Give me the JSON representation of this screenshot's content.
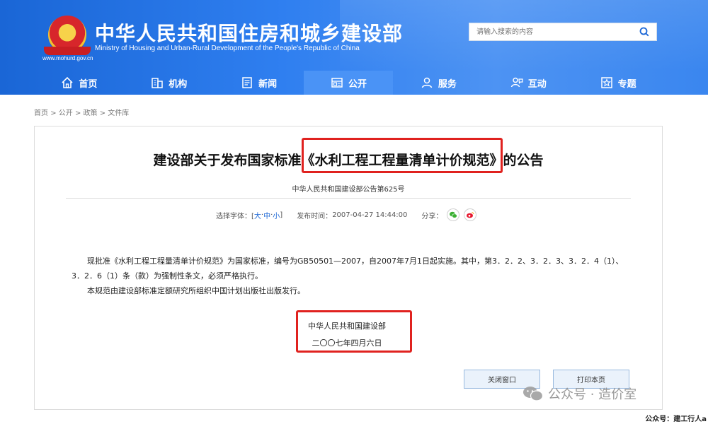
{
  "header": {
    "title": "中华人民共和国住房和城乡建设部",
    "subtitle": "Ministry of Housing and Urban-Rural Development of the People's Republic of China",
    "url": "www.mohurd.gov.cn",
    "search_placeholder": "请输入搜索的内容"
  },
  "nav": [
    {
      "label": "首页",
      "icon": "home-icon"
    },
    {
      "label": "机构",
      "icon": "building-icon"
    },
    {
      "label": "新闻",
      "icon": "news-icon"
    },
    {
      "label": "公开",
      "icon": "document-icon",
      "active": true
    },
    {
      "label": "服务",
      "icon": "service-icon"
    },
    {
      "label": "互动",
      "icon": "interaction-icon"
    },
    {
      "label": "专题",
      "icon": "topic-icon"
    }
  ],
  "breadcrumb": [
    "首页",
    "公开",
    "政策",
    "文件库"
  ],
  "breadcrumb_sep": ">",
  "article": {
    "title": "建设部关于发布国家标准《水利工程工程量清单计价规范》的公告",
    "doc_number": "中华人民共和国建设部公告第625号",
    "font_label": "选择字体：[",
    "font_large": "大",
    "font_medium": "中",
    "font_small": "小",
    "font_sep": "·",
    "font_close": "]",
    "publish_label": "发布时间：",
    "publish_time": "2007-04-27 14:44:00",
    "share_label": "分享：",
    "paragraph1": "现批准《水利工程工程量清单计价规范》为国家标准，编号为GB50501—2007，自2007年7月1日起实施。其中，第3．2．2、3．2．3、3．2．4（1）、3．2．6（1）条（款）为强制性条文，必须严格执行。",
    "paragraph2": "本规范由建设部标准定额研究所组织中国计划出版社出版发行。",
    "signature_org": "中华人民共和国建设部",
    "signature_date": "二〇〇七年四月六日"
  },
  "buttons": {
    "close": "关闭窗口",
    "print": "打印本页"
  },
  "watermark": "公众号 · 造价室",
  "footer_credit": "公众号：建工行人a",
  "colors": {
    "header_blue": "#2f7ff0",
    "nav_active": "#4a93f6",
    "highlight_red": "#e0221f"
  }
}
